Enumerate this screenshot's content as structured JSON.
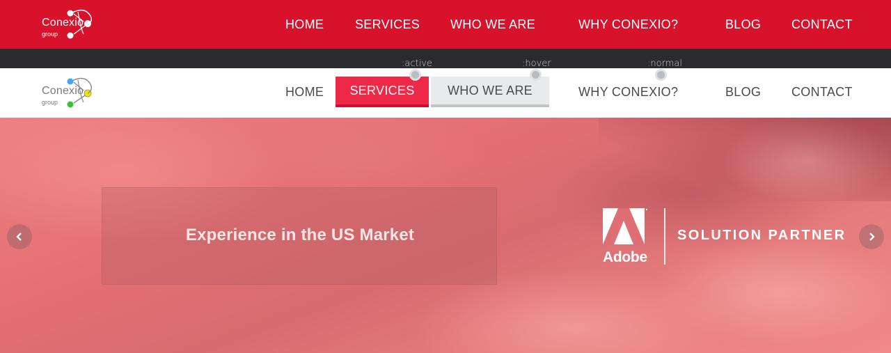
{
  "brand": {
    "name": "Conexio",
    "sub": "group",
    "colors": {
      "red": "#d8122b",
      "active": "#ee2847",
      "hover_bg": "#e8eaeb",
      "dot_blue": "#3fa9f5",
      "dot_yellow": "#f4e300",
      "dot_green": "#3ac03a"
    }
  },
  "nav_red": {
    "items": [
      "HOME",
      "SERVICES",
      "WHO WE ARE",
      "WHY CONEXIO?",
      "BLOG",
      "CONTACT"
    ]
  },
  "states": {
    "active": ":active",
    "hover": ":hover",
    "normal": ":normal"
  },
  "nav_white": {
    "items": [
      "HOME",
      "SERVICES",
      "WHO WE ARE",
      "WHY CONEXIO?",
      "BLOG",
      "CONTACT"
    ]
  },
  "hero": {
    "caption": "Experience in the US Market",
    "prev_icon": "chevron-left-icon",
    "next_icon": "chevron-right-icon",
    "prev_glyph": "‹",
    "next_glyph": "›",
    "partner_brand": "Adobe",
    "partner_label": "SOLUTION PARTNER"
  }
}
